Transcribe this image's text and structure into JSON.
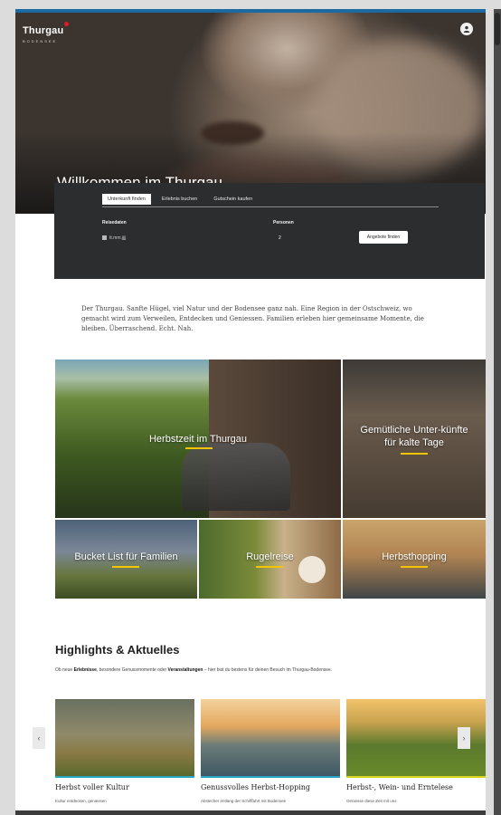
{
  "brand": {
    "logo": "Thurgau",
    "tagline": "BODENSEE"
  },
  "hero": {
    "title": "Willkommen im Thurgau"
  },
  "booking": {
    "tabs": [
      "Unterkunft finden",
      "Erlebnis buchen",
      "Gutschein kaufen"
    ],
    "active_tab": 0,
    "date_label": "Reisedaten",
    "date_value": "tt.mm.jjjj",
    "persons_label": "Personen",
    "persons_value": "2",
    "search_label": "Angebote finden"
  },
  "intro": "Der Thurgau. Sanfte Hügel, viel Natur und der Bodensee ganz nah. Eine Region in der Ostschweiz, wo gemacht wird zum Verweilen, Entdecken und Geniessen. Familien erleben hier gemeinsame Momente, die bleiben. Überraschend. Echt. Nah.",
  "tiles": [
    {
      "label": "Herbstzeit im Thurgau"
    },
    {
      "label": "Gemütliche Unter-künfte für kalte Tage"
    },
    {
      "label": "Bucket List für Familien"
    },
    {
      "label": "Rugelreise"
    },
    {
      "label": "Herbsthopping"
    }
  ],
  "highlights": {
    "title": "Highlights & Aktuelles",
    "desc_pre": "Ob neue ",
    "desc_b1": "Erlebnisse",
    "desc_mid": ", besondere Genussmomente oder ",
    "desc_b2": "Veranstaltungen",
    "desc_post": " – hier bist du bestens für deinen Besuch im Thurgau-Bodensee.",
    "cards": [
      {
        "title": "Herbst voller Kultur",
        "sub": "Kultur entdecken, geniessen"
      },
      {
        "title": "Genussvolles Herbst-Hopping",
        "sub": "Abstecher entlang der Schifffahrt mit Bodensee"
      },
      {
        "title": "Herbst-, Wein- und Erntelese",
        "sub": "Geniesse diese Zeit mit uns"
      }
    ],
    "prev": "‹",
    "next": "›"
  }
}
